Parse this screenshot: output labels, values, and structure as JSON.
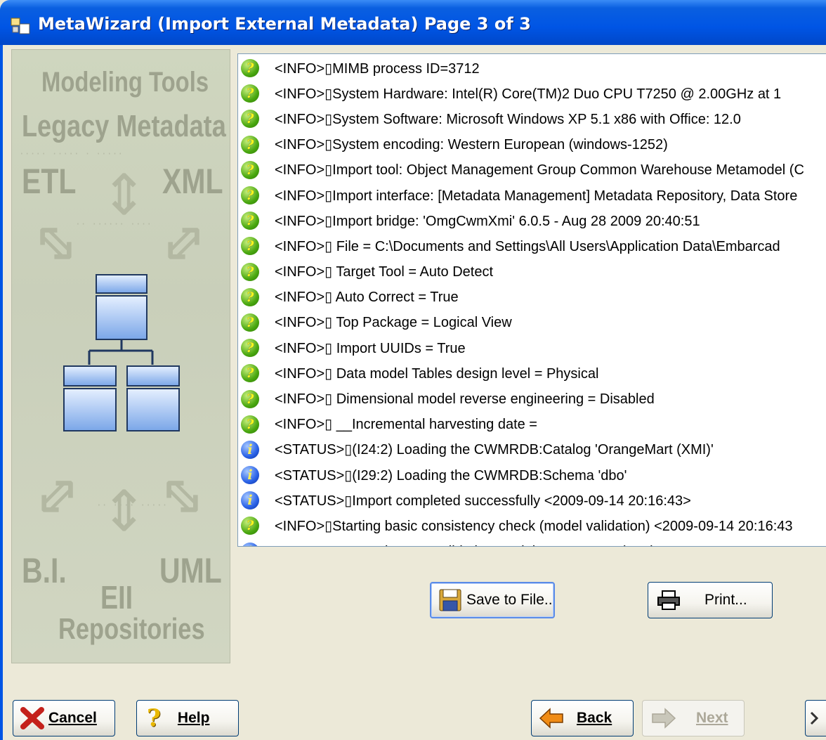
{
  "window": {
    "title": "MetaWizard (Import External Metadata) Page 3 of 3"
  },
  "banner": {
    "headings": [
      "Modeling Tools",
      "Legacy Metadata",
      "ETL",
      "XML",
      "B.I.",
      "EII",
      "UML",
      "Repositories"
    ]
  },
  "log": {
    "rows": [
      {
        "type": "info",
        "text": "<INFO>▯MIMB process ID=3712"
      },
      {
        "type": "info",
        "text": "<INFO>▯System Hardware: Intel(R) Core(TM)2 Duo CPU     T7250  @ 2.00GHz at 1"
      },
      {
        "type": "info",
        "text": "<INFO>▯System Software: Microsoft Windows XP 5.1 x86 with Office: 12.0"
      },
      {
        "type": "info",
        "text": "<INFO>▯System encoding: Western European (windows-1252)"
      },
      {
        "type": "info",
        "text": "<INFO>▯Import tool: Object Management Group Common Warehouse Metamodel (C"
      },
      {
        "type": "info",
        "text": "<INFO>▯Import interface: [Metadata Management] Metadata Repository, Data Store"
      },
      {
        "type": "info",
        "text": "<INFO>▯Import bridge: 'OmgCwmXmi' 6.0.5 - Aug 28 2009 20:40:51"
      },
      {
        "type": "info",
        "text": "<INFO>▯    File = C:\\Documents and Settings\\All Users\\Application Data\\Embarcad"
      },
      {
        "type": "info",
        "text": "<INFO>▯    Target Tool = Auto Detect"
      },
      {
        "type": "info",
        "text": "<INFO>▯    Auto Correct = True"
      },
      {
        "type": "info",
        "text": "<INFO>▯    Top Package = Logical View"
      },
      {
        "type": "info",
        "text": "<INFO>▯    Import UUIDs = True"
      },
      {
        "type": "info",
        "text": "<INFO>▯    Data model Tables design level = Physical"
      },
      {
        "type": "info",
        "text": "<INFO>▯    Dimensional model reverse engineering = Disabled"
      },
      {
        "type": "info",
        "text": "<INFO>▯    __Incremental harvesting date ="
      },
      {
        "type": "status",
        "text": "<STATUS>▯(I24:2) Loading the CWMRDB:Catalog 'OrangeMart (XMI)'"
      },
      {
        "type": "status",
        "text": "<STATUS>▯(I29:2) Loading the CWMRDB:Schema 'dbo'"
      },
      {
        "type": "status",
        "text": "<STATUS>▯Import completed successfully <2009-09-14 20:16:43>"
      },
      {
        "type": "info",
        "text": "<INFO>▯Starting basic consistency check (model validation) <2009-09-14 20:16:43"
      },
      {
        "type": "status",
        "text": "<STATUS>▯Consistency Validation model 'OrangeMart (XMI)'"
      }
    ]
  },
  "buttons": {
    "save": "Save to File..",
    "print": "Print...",
    "cancel": "Cancel",
    "help": "Help",
    "back": "Back",
    "next": "Next"
  }
}
